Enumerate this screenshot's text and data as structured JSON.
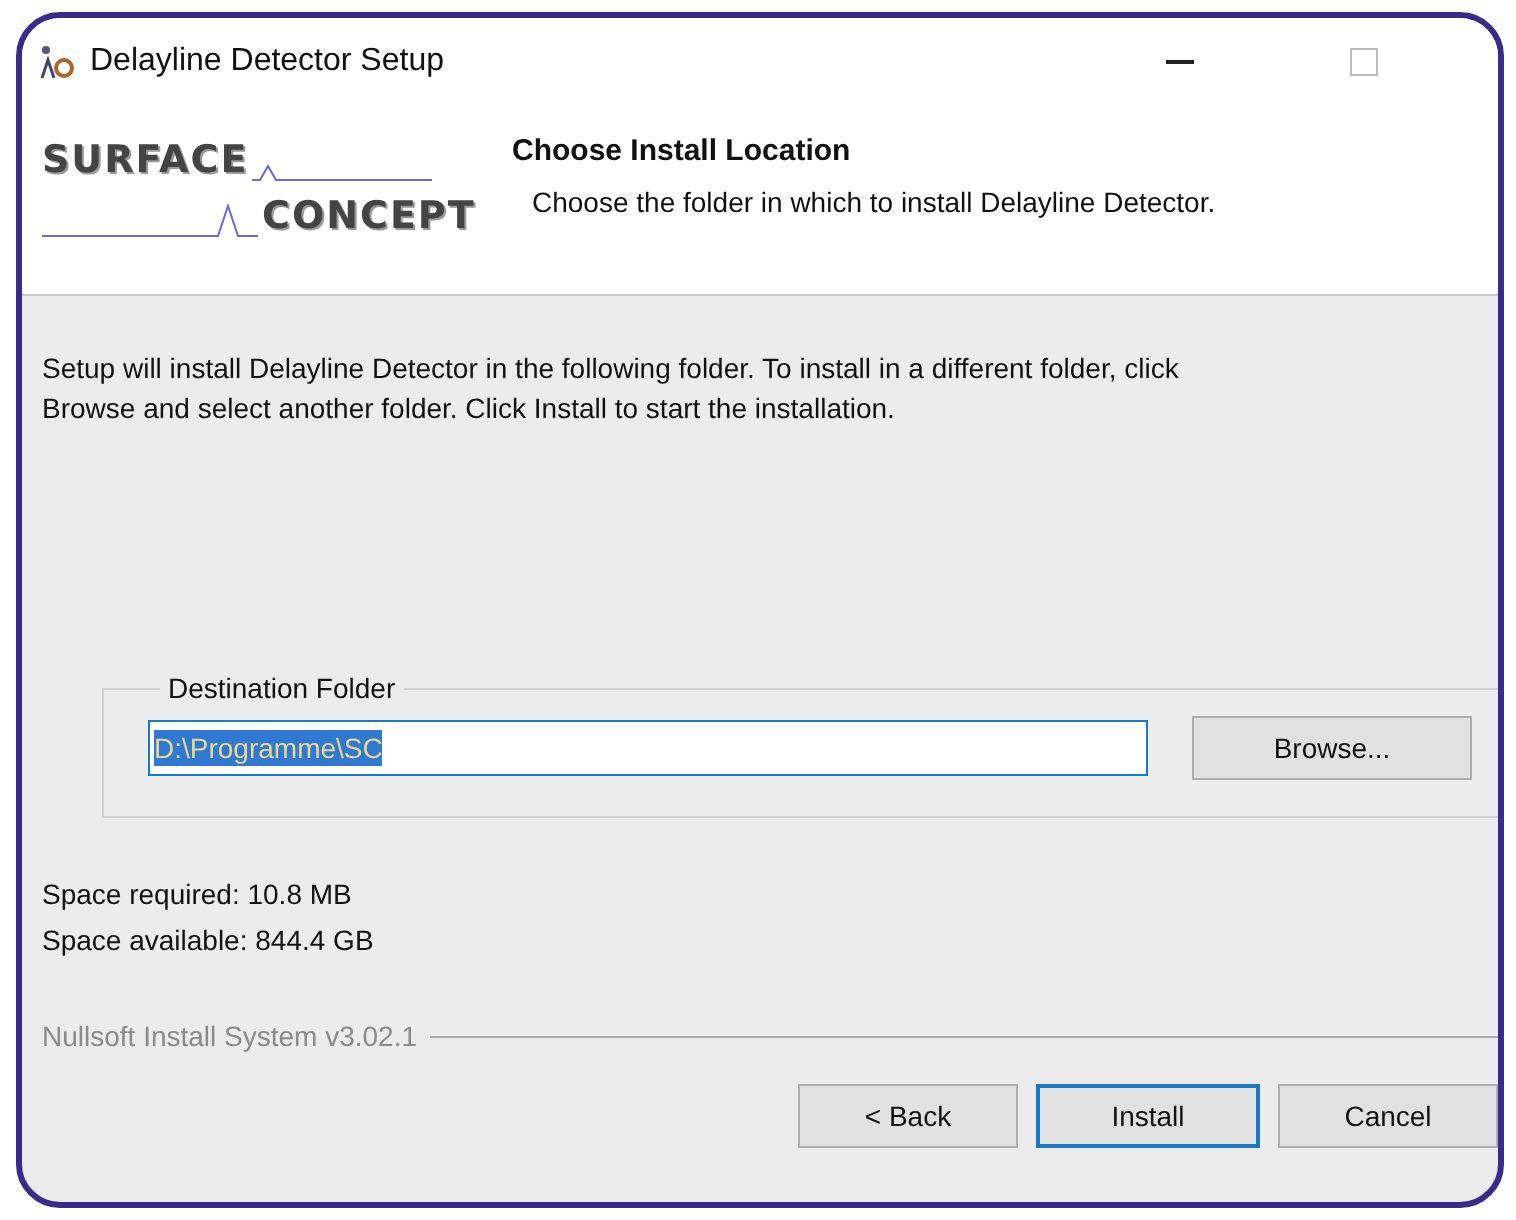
{
  "window": {
    "title": "Delayline Detector Setup"
  },
  "logo": {
    "line_1": "SURFACE",
    "line_2": "CONCEPT"
  },
  "header": {
    "title": "Choose Install Location",
    "subtitle": "Choose the folder in which to install Delayline Detector."
  },
  "intro": [
    "Setup will install Delayline Detector in the following folder. To install in a different folder, click",
    "Browse and select another folder. Click Install to start the installation."
  ],
  "destination": {
    "legend": "Destination Folder",
    "value": "D:\\Programme\\SC",
    "selected": true,
    "browse": "Browse..."
  },
  "space": [
    "Space required: 10.8 MB",
    "Space available: 844.4 GB"
  ],
  "branding": "Nullsoft Install System v3.02.1",
  "buttons": [
    {
      "label": "< Back",
      "default": false
    },
    {
      "label": "Install",
      "default": true
    },
    {
      "label": "Cancel",
      "default": false
    }
  ]
}
